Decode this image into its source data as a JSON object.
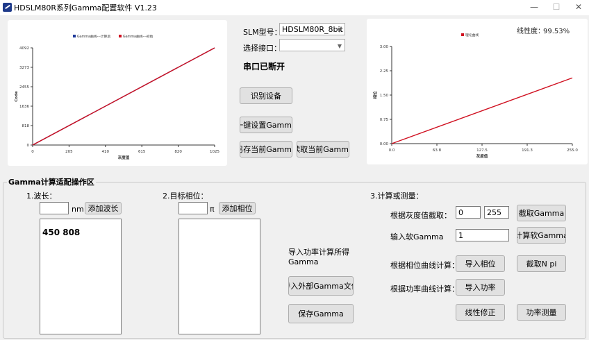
{
  "window": {
    "title": "HDSLM80R系列Gamma配置软件 V1.23",
    "minimize": "—",
    "maximize": "☐",
    "close": "✕"
  },
  "left_chart_text": {
    "legend": [
      "Gamma曲线---计算后",
      "Gamma曲线---初始"
    ],
    "ylabel": "Code",
    "xlabel": "灰度值"
  },
  "right_chart_text": {
    "legend": [
      "理论曲线"
    ],
    "ylabel": "相位",
    "xlabel": "灰度值",
    "linearity_label": "线性度：",
    "linearity_value": "99.53%"
  },
  "chart_data": [
    {
      "type": "line",
      "title": "",
      "xlabel": "灰度值",
      "ylabel": "Code",
      "x_ticks": [
        "0",
        "205",
        "410",
        "615",
        "820",
        "1025"
      ],
      "y_ticks": [
        "0",
        "818",
        "1636",
        "2455",
        "3273",
        "4092"
      ],
      "xlim": [
        0,
        1025
      ],
      "ylim": [
        0,
        4092
      ],
      "series": [
        {
          "name": "Gamma曲线---计算后",
          "color": "#1f3a9a",
          "x": [
            0,
            1025
          ],
          "y": [
            0,
            4092
          ]
        },
        {
          "name": "Gamma曲线---初始",
          "color": "#d01020",
          "x": [
            0,
            1025
          ],
          "y": [
            0,
            4092
          ]
        }
      ],
      "grid": false,
      "legend": "top-center"
    },
    {
      "type": "line",
      "title": "",
      "xlabel": "灰度值",
      "ylabel": "相位",
      "x_ticks": [
        "0.0",
        "63.8",
        "127.5",
        "191.3",
        "255.0"
      ],
      "y_ticks": [
        "0.00",
        "0.75",
        "1.50",
        "2.25",
        "3.00"
      ],
      "xlim": [
        0,
        255
      ],
      "ylim": [
        0,
        3
      ],
      "series": [
        {
          "name": "理论曲线",
          "color": "#d01020",
          "x": [
            0,
            255
          ],
          "y": [
            0,
            2.03
          ]
        }
      ],
      "grid": false,
      "legend": "top-left"
    }
  ],
  "controls": {
    "slm_model_label": "SLM型号：",
    "slm_model_value": "HDSLM80R_8bit",
    "port_label": "选择接口：",
    "port_value": "",
    "port_status": "串口已断开",
    "identify_button": "识别设备",
    "one_click_button": "一键设置Gamma",
    "save_current_button": "另存当前Gamma",
    "read_current_button": "读取当前Gamma"
  },
  "workspace": {
    "title": "Gamma计算适配操作区",
    "wavelength": {
      "heading": "1.波长：",
      "input_value": "",
      "unit": "nm",
      "add_button": "添加波长",
      "list_text": "450 808"
    },
    "phase": {
      "heading": "2.目标相位：",
      "input_value": "",
      "unit": "π",
      "add_button": "添加相位",
      "list_text": ""
    },
    "import_power_text": "导入功率计算所得Gamma",
    "import_external_button": "导入外部Gamma文件",
    "save_gamma_button": "保存Gamma",
    "calc": {
      "heading": "3.计算或测量：",
      "grayscale_label": "根据灰度值截取：",
      "gray_from": "0",
      "gray_to": "255",
      "cut_gamma_button": "截取Gamma",
      "soft_gamma_label": "输入软Gamma",
      "soft_gamma_value": "1",
      "calc_soft_button": "计算软Gamma",
      "phase_curve_label": "根据相位曲线计算：",
      "import_phase_button": "导入相位",
      "cut_npi_button": "截取N pi",
      "power_curve_label": "根据功率曲线计算：",
      "import_power_button": "导入功率",
      "linear_fix_button": "线性修正",
      "power_measure_button": "功率测量"
    }
  }
}
